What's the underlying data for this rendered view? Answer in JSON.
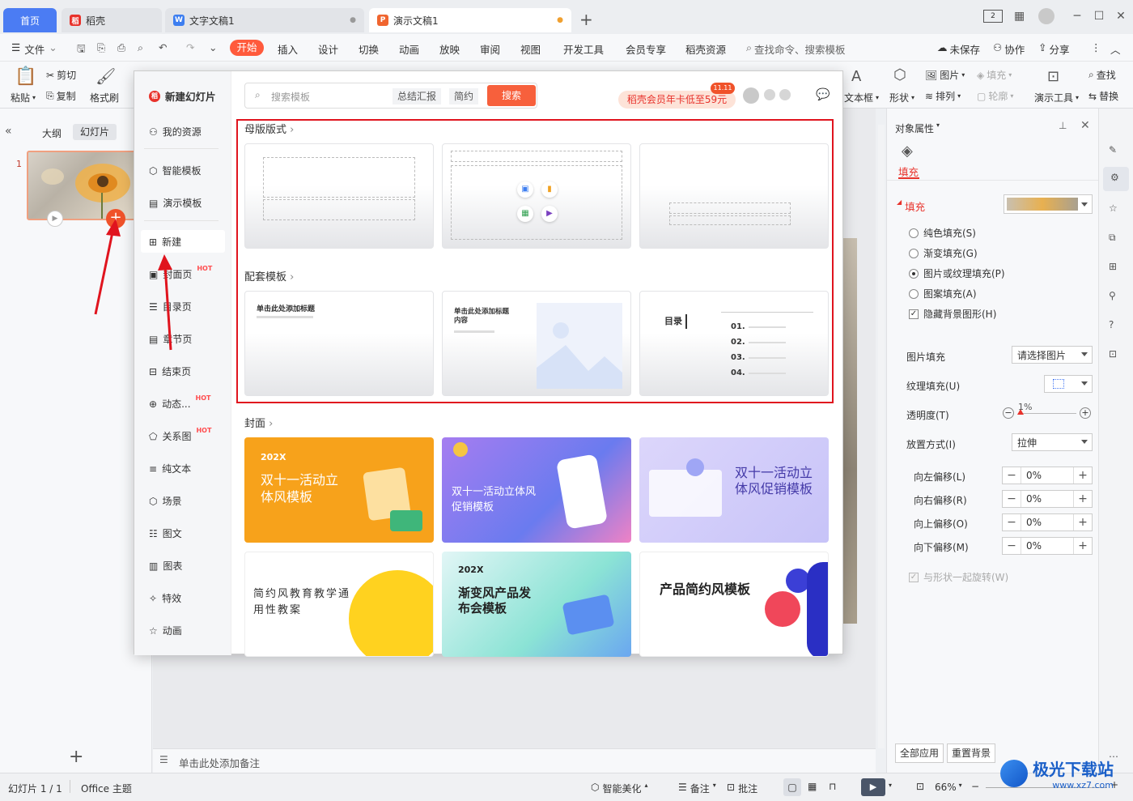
{
  "tabs": [
    {
      "label": "首页",
      "active": false,
      "kind": "home"
    },
    {
      "label": "稻壳",
      "active": false
    },
    {
      "label": "文字文稿1",
      "active": false
    },
    {
      "label": "演示文稿1",
      "active": true
    }
  ],
  "menu": {
    "file": "文件",
    "items": [
      "开始",
      "插入",
      "设计",
      "切换",
      "动画",
      "放映",
      "审阅",
      "视图",
      "开发工具",
      "会员专享",
      "稻壳资源"
    ],
    "search": "查找命令、搜索模板",
    "unsaved": "未保存",
    "collab": "协作",
    "share": "分享"
  },
  "ribbon": {
    "paste": "粘贴",
    "cut": "剪切",
    "copy": "复制",
    "format_painter": "格式刷",
    "textbox": "文本框",
    "shape": "形状",
    "picture": "图片",
    "arrange": "排列",
    "fill": "填充",
    "outline": "轮廓",
    "present_tools": "演示工具",
    "find": "查找",
    "replace": "替换"
  },
  "left_panel": {
    "tab_outline": "大纲",
    "tab_slides": "幻灯片",
    "slide_number": "1"
  },
  "notes_placeholder": "单击此处添加备注",
  "popup": {
    "title": "新建幻灯片",
    "nav": [
      {
        "label": "我的资源",
        "hot": ""
      },
      {
        "label": "智能模板",
        "hot": ""
      },
      {
        "label": "演示模板",
        "hot": ""
      },
      {
        "label": "新建",
        "hot": ""
      },
      {
        "label": "封面页",
        "hot": "HOT"
      },
      {
        "label": "目录页",
        "hot": ""
      },
      {
        "label": "章节页",
        "hot": ""
      },
      {
        "label": "结束页",
        "hot": ""
      },
      {
        "label": "动态...",
        "hot": "HOT"
      },
      {
        "label": "关系图",
        "hot": "HOT"
      },
      {
        "label": "纯文本",
        "hot": ""
      },
      {
        "label": "场景",
        "hot": ""
      },
      {
        "label": "图文",
        "hot": ""
      },
      {
        "label": "图表",
        "hot": ""
      },
      {
        "label": "特效",
        "hot": ""
      },
      {
        "label": "动画",
        "hot": ""
      }
    ],
    "search_placeholder": "搜索模板",
    "tag1": "总结汇报",
    "tag2": "简约",
    "search_btn": "搜索",
    "promo": "稻壳会员年卡低至59元",
    "promo_badge": "11.11",
    "sections": {
      "master": "母版版式",
      "matching": "配套模板",
      "cover": "封面"
    },
    "matching_cards": {
      "c1_title": "单击此处添加标题",
      "c2_title": "单击此处添加标题内容",
      "c3_title": "目录",
      "c3_items": [
        "01.",
        "02.",
        "03.",
        "04."
      ]
    },
    "cover_cards": {
      "c1_year": "202X",
      "c1_title": "双十一活动立体风模板",
      "c2_title": "双十一活动立体风促销模板",
      "c3_title": "双十一活动立体风促销模板",
      "c4_title": "简约风教育教学通用性教案",
      "c5_year": "202X",
      "c5_title": "渐变风产品发布会模板",
      "c6_title": "产品简约风模板"
    }
  },
  "right_panel": {
    "header": "对象属性",
    "fill_tab": "填充",
    "fill_section": "填充",
    "options": [
      "纯色填充(S)",
      "渐变填充(G)",
      "图片或纹理填充(P)",
      "图案填充(A)"
    ],
    "selected_option": 2,
    "hide_bg": "隐藏背景图形(H)",
    "pic_fill_label": "图片填充",
    "pic_fill_value": "请选择图片",
    "texture_label": "纹理填充(U)",
    "transparency_label": "透明度(T)",
    "transparency_value": "1%",
    "placement_label": "放置方式(I)",
    "placement_value": "拉伸",
    "offsets": [
      {
        "label": "向左偏移(L)",
        "value": "0%"
      },
      {
        "label": "向右偏移(R)",
        "value": "0%"
      },
      {
        "label": "向上偏移(O)",
        "value": "0%"
      },
      {
        "label": "向下偏移(M)",
        "value": "0%"
      }
    ],
    "rotate_with_shape": "与形状一起旋转(W)",
    "apply_all": "全部应用",
    "reset_bg": "重置背景"
  },
  "status": {
    "slide": "幻灯片 1 / 1",
    "theme": "Office 主题",
    "beautify": "智能美化",
    "notes": "备注",
    "comment": "批注",
    "zoom": "66%"
  },
  "watermark": {
    "name": "极光下载站",
    "url": "www.xz7.com"
  },
  "colors": {
    "accent": "#ff5a3c",
    "highlight_box": "#e0141e",
    "arrow": "#e0141e"
  }
}
